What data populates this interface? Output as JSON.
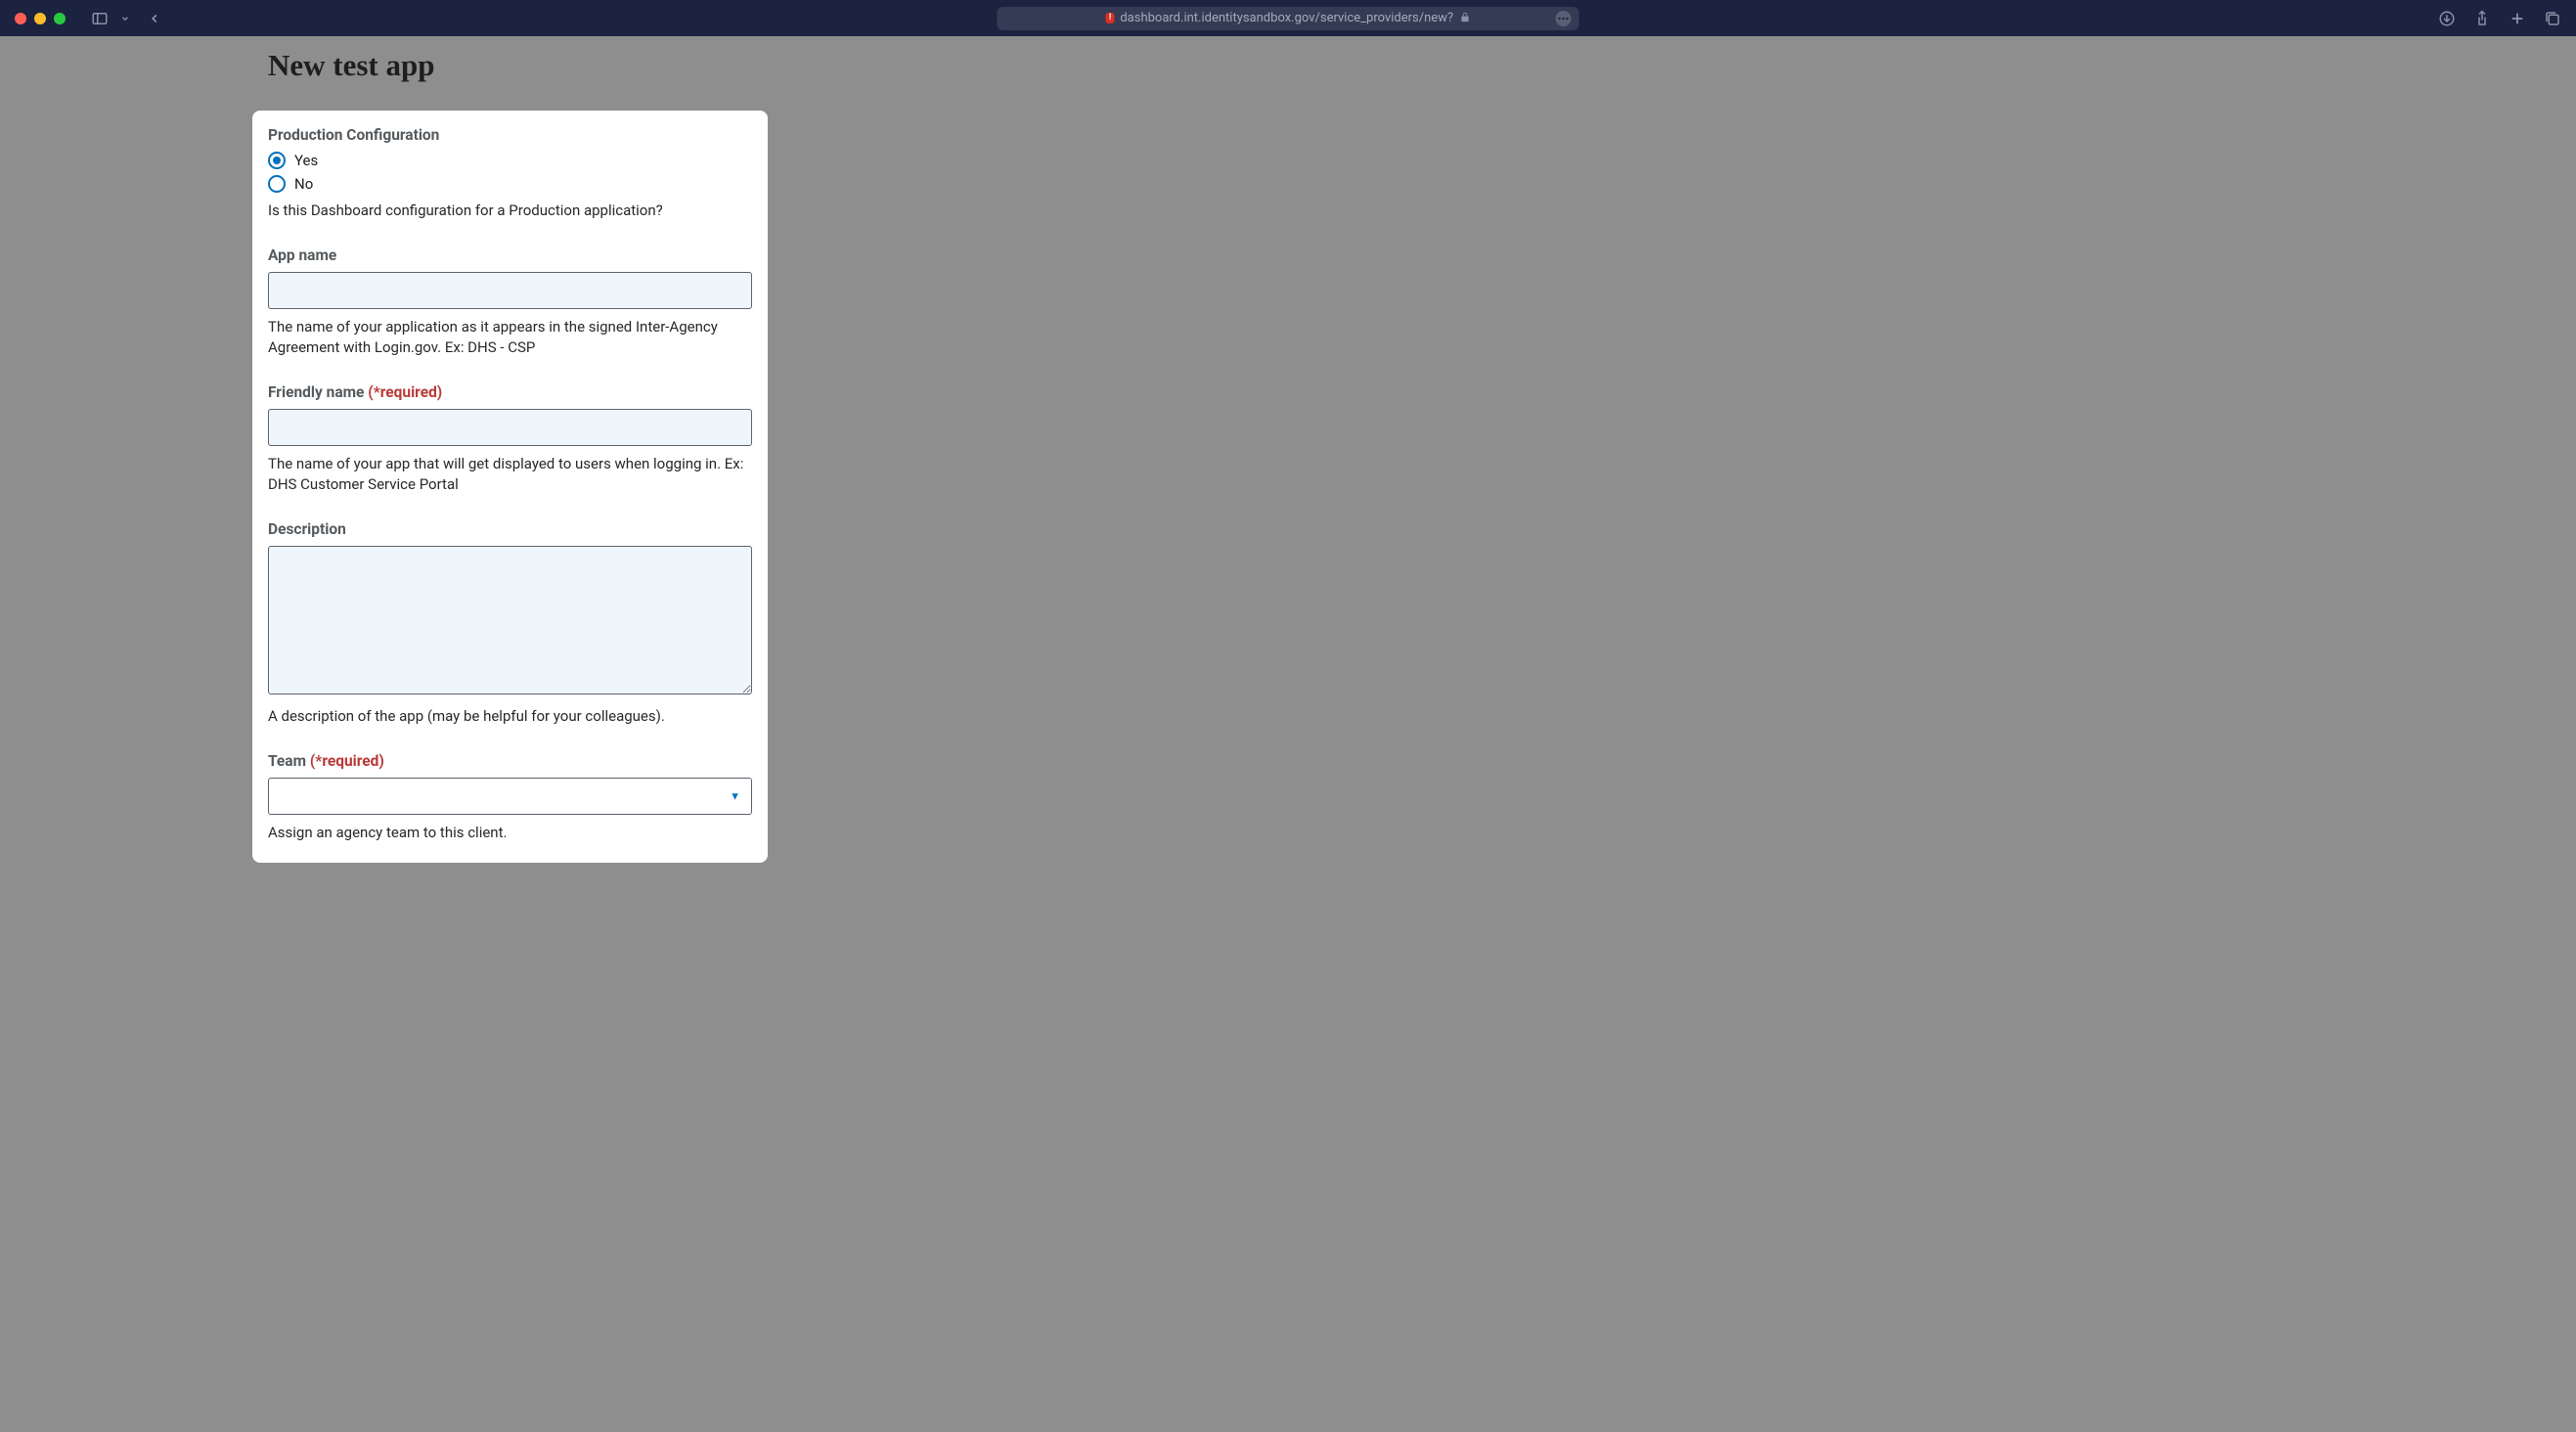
{
  "browser": {
    "url": "dashboard.int.identitysandbox.gov/service_providers/new?"
  },
  "page": {
    "title": "New test app"
  },
  "form": {
    "production_config": {
      "label": "Production Configuration",
      "option_yes": "Yes",
      "option_no": "No",
      "selected": "yes",
      "help": "Is this Dashboard configuration for a Production application?"
    },
    "app_name": {
      "label": "App name",
      "value": "",
      "help": "The name of your application as it appears in the signed Inter-Agency Agreement with Login.gov. Ex: DHS - CSP"
    },
    "friendly_name": {
      "label": "Friendly name",
      "required_tag": "(*required)",
      "value": "",
      "help": "The name of your app that will get displayed to users when logging in. Ex: DHS Customer Service Portal"
    },
    "description": {
      "label": "Description",
      "value": "",
      "help": "A description of the app (may be helpful for your colleagues)."
    },
    "team": {
      "label": "Team",
      "required_tag": "(*required)",
      "selected": "",
      "help": "Assign an agency team to this client."
    }
  }
}
